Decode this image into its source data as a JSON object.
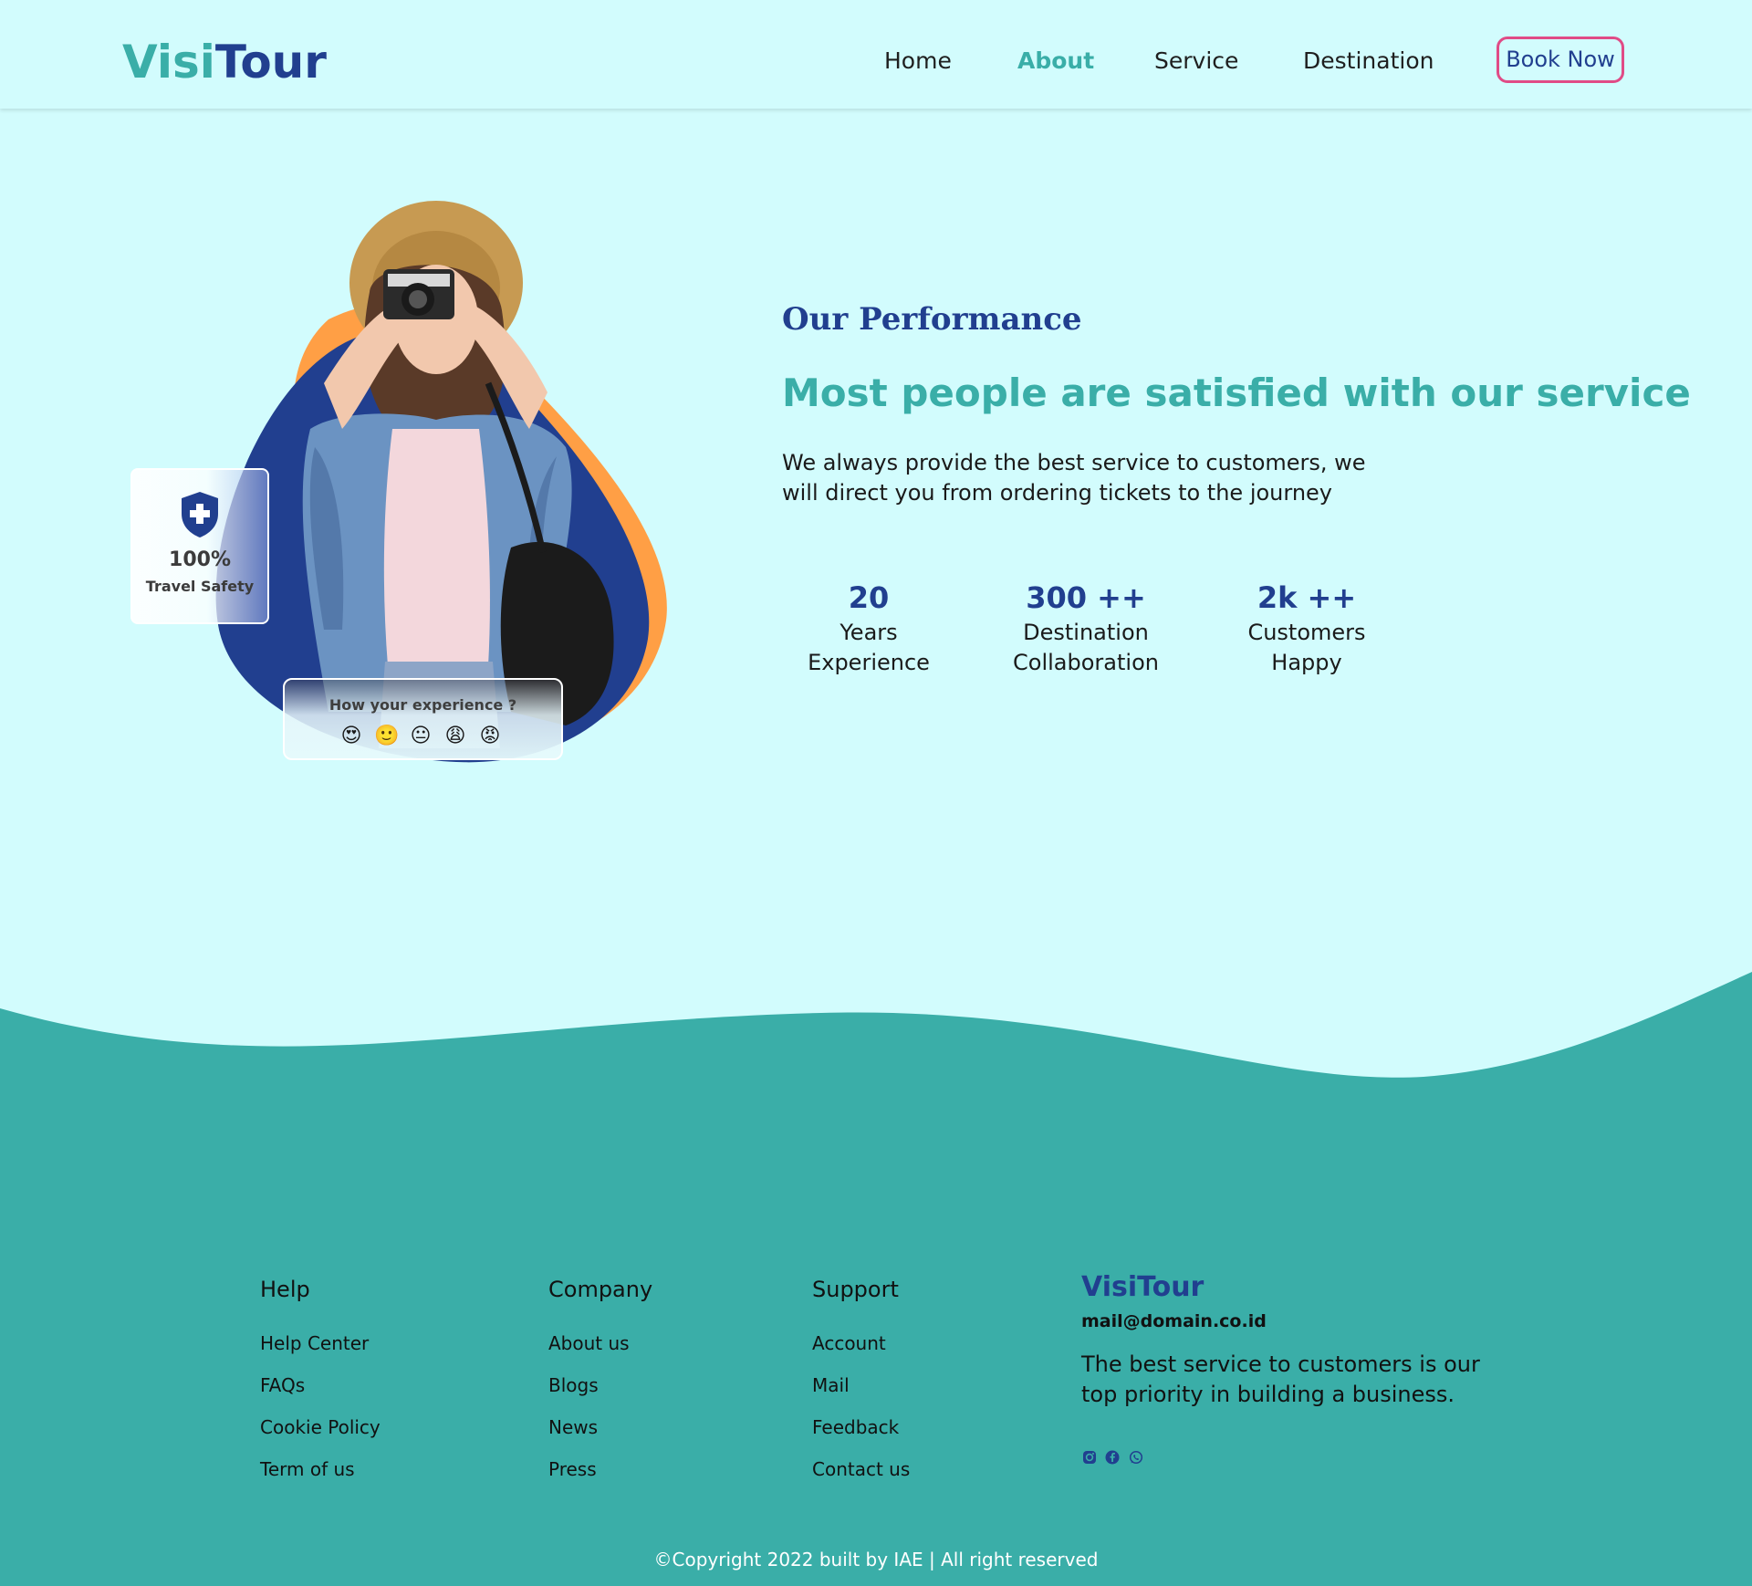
{
  "brand": {
    "part1": "Visi",
    "part2": "Tour"
  },
  "nav": {
    "home": "Home",
    "about": "About",
    "service": "Service",
    "destination": "Destination",
    "book_now": "Book Now"
  },
  "hero": {
    "safety_percent": "100%",
    "safety_label": "Travel Safety",
    "experience_question": "How your experience ?",
    "emojis": [
      "😍",
      "🙂",
      "😐",
      "😩",
      "😡"
    ]
  },
  "performance": {
    "label": "Our Performance",
    "headline": "Most people are satisfied with our service",
    "description": "We always provide the best service to customers, we will direct you from ordering tickets to the journey",
    "stats": [
      {
        "number": "20",
        "line1": "Years",
        "line2": "Experience"
      },
      {
        "number": "300 ++",
        "line1": "Destination",
        "line2": "Collaboration"
      },
      {
        "number": "2k ++",
        "line1": "Customers",
        "line2": "Happy"
      }
    ]
  },
  "footer": {
    "help": {
      "title": "Help",
      "links": [
        "Help Center",
        "FAQs",
        "Cookie Policy",
        "Term of us"
      ]
    },
    "company": {
      "title": "Company",
      "links": [
        "About us",
        "Blogs",
        "News",
        "Press"
      ]
    },
    "support": {
      "title": "Support",
      "links": [
        "Account",
        "Mail",
        "Feedback",
        "Contact us"
      ]
    },
    "brand": "VisiTour",
    "email": "mail@domain.co.id",
    "description": "The best service to customers is our top priority in building a business.",
    "social_icons": [
      "instagram-icon",
      "facebook-icon",
      "whatsapp-icon"
    ],
    "copyright": "©Copyright 2022 built by IAE | All right reserved"
  },
  "colors": {
    "background": "#d2fcfd",
    "teal": "#3aaea8",
    "navy": "#213f8f",
    "orange": "#ff9f45",
    "pink_border": "#e04b86"
  }
}
